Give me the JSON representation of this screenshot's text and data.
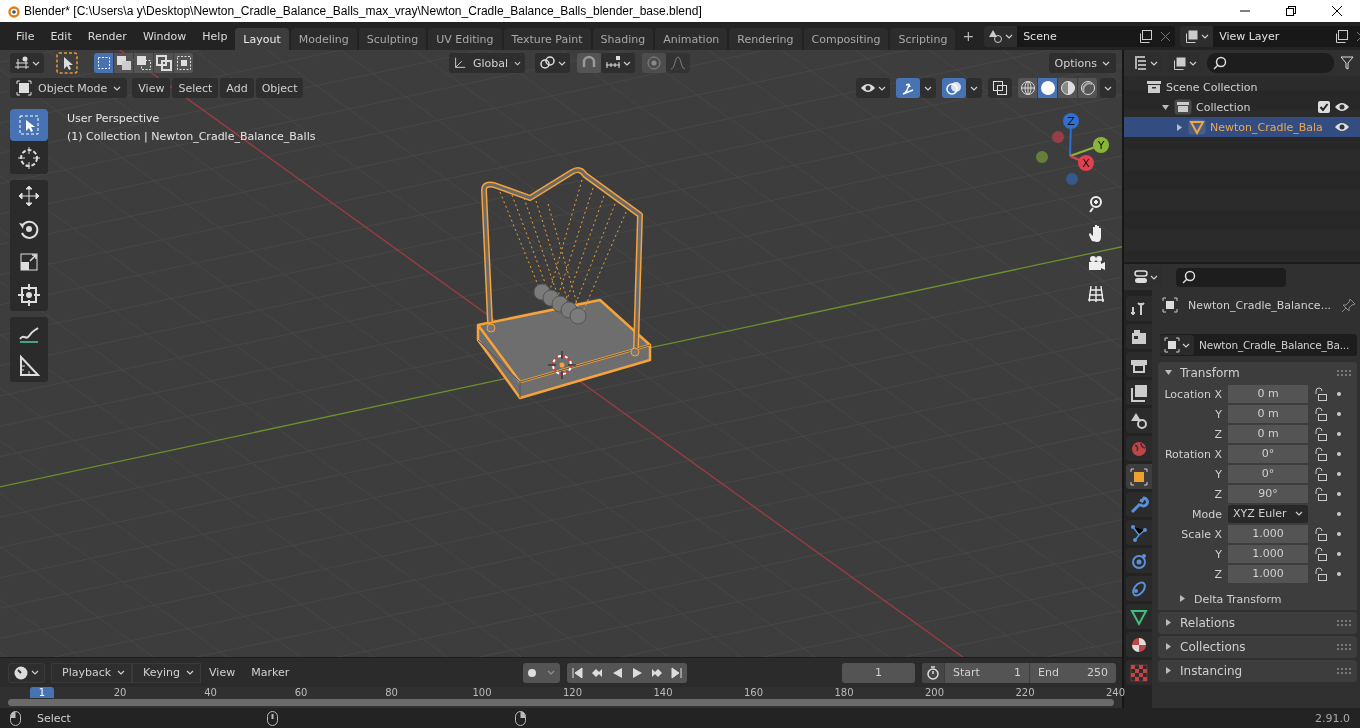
{
  "window": {
    "title": "Blender* [C:\\Users\\a y\\Desktop\\Newton_Cradle_Balance_Balls_max_vray\\Newton_Cradle_Balance_Balls_blender_base.blend]"
  },
  "menu": [
    "File",
    "Edit",
    "Render",
    "Window",
    "Help"
  ],
  "workspaces": [
    {
      "label": "Layout",
      "selected": true
    },
    {
      "label": "Modeling",
      "selected": false
    },
    {
      "label": "Sculpting",
      "selected": false
    },
    {
      "label": "UV Editing",
      "selected": false
    },
    {
      "label": "Texture Paint",
      "selected": false
    },
    {
      "label": "Shading",
      "selected": false
    },
    {
      "label": "Animation",
      "selected": false
    },
    {
      "label": "Rendering",
      "selected": false
    },
    {
      "label": "Compositing",
      "selected": false
    },
    {
      "label": "Scripting",
      "selected": false
    }
  ],
  "add_workspace": "+",
  "scene": {
    "value": "Scene"
  },
  "view_layer": {
    "value": "View Layer"
  },
  "viewport": {
    "select_modes": [
      {
        "selected": true
      },
      {
        "selected": false
      },
      {
        "selected": false
      },
      {
        "selected": false
      },
      {
        "selected": false
      }
    ],
    "orientation": "Global",
    "options": "Options",
    "mode": "Object Mode",
    "menus": [
      "View",
      "Select",
      "Add",
      "Object"
    ],
    "overlay_text": [
      "User Perspective",
      "(1) Collection | Newton_Cradle_Balance_Balls"
    ],
    "toolbar": [
      {
        "tools": [
          {
            "kind": "select",
            "selected": true
          },
          {
            "kind": "cursor",
            "selected": false
          }
        ]
      },
      {
        "tools": [
          {
            "kind": "move",
            "selected": false
          },
          {
            "kind": "rotate",
            "selected": false
          },
          {
            "kind": "scale",
            "selected": false
          },
          {
            "kind": "transform",
            "selected": false
          }
        ]
      },
      {
        "tools": [
          {
            "kind": "annotate",
            "selected": false
          },
          {
            "kind": "measure",
            "selected": false
          }
        ]
      }
    ],
    "shading": [
      {
        "kind": "wireframe",
        "selected": false
      },
      {
        "kind": "solid",
        "selected": true
      },
      {
        "kind": "material",
        "selected": false
      },
      {
        "kind": "rendered",
        "selected": false
      }
    ],
    "gizmo": [
      {
        "label": "Z",
        "color": "#2f6fd0"
      },
      {
        "label": "Y",
        "color": "#8ab536"
      },
      {
        "label": "X",
        "color": "#e0404f"
      }
    ]
  },
  "outliner": {
    "items": [
      {
        "label": "Scene Collection",
        "selected": false,
        "children": [
          {
            "label": "Collection",
            "selected": false,
            "expanded": true,
            "checked": true,
            "children": [
              {
                "label": "Newton_Cradle_Bala",
                "selected": true,
                "expanded": false
              }
            ]
          }
        ]
      }
    ]
  },
  "properties": {
    "tabs": [
      {
        "kind": "tool",
        "selected": false
      },
      {
        "kind": "render",
        "selected": false
      },
      {
        "kind": "output",
        "selected": false
      },
      {
        "kind": "view_layer",
        "selected": false
      },
      {
        "kind": "scene",
        "selected": false
      },
      {
        "kind": "world",
        "selected": false
      },
      {
        "kind": "object",
        "selected": true
      },
      {
        "kind": "modifiers",
        "selected": false
      },
      {
        "kind": "particles",
        "selected": false
      },
      {
        "kind": "physics",
        "selected": false
      },
      {
        "kind": "constraints",
        "selected": false
      },
      {
        "kind": "data",
        "selected": false
      },
      {
        "kind": "material",
        "selected": false
      },
      {
        "kind": "texture",
        "selected": false
      }
    ],
    "object_name": "Newton_Cradle_Balance...",
    "data_name": "Newton_Cradle_Balance_Ba...",
    "transform": {
      "title": "Transform",
      "expanded": true,
      "rows": [
        {
          "label": "Location X",
          "value": "0 m",
          "kind": "number"
        },
        {
          "label": "Y",
          "value": "0 m",
          "kind": "number"
        },
        {
          "label": "Z",
          "value": "0 m",
          "kind": "number"
        },
        {
          "label": "Rotation X",
          "value": "0°",
          "kind": "number"
        },
        {
          "label": "Y",
          "value": "0°",
          "kind": "number"
        },
        {
          "label": "Z",
          "value": "90°",
          "kind": "number"
        },
        {
          "label": "Mode",
          "value": "XYZ Euler",
          "kind": "dropdown"
        },
        {
          "label": "Scale X",
          "value": "1.000",
          "kind": "number"
        },
        {
          "label": "Y",
          "value": "1.000",
          "kind": "number"
        },
        {
          "label": "Z",
          "value": "1.000",
          "kind": "number"
        }
      ],
      "subpanel": {
        "title": "Delta Transform",
        "expanded": false
      }
    },
    "panels": [
      {
        "title": "Relations",
        "expanded": false
      },
      {
        "title": "Collections",
        "expanded": false
      },
      {
        "title": "Instancing",
        "expanded": false
      }
    ]
  },
  "timeline": {
    "menus": [
      "Playback",
      "Keying"
    ],
    "plain_menus": [
      "View",
      "Marker"
    ],
    "current_frame": "1",
    "start_label": "Start",
    "start": "1",
    "end_label": "End",
    "end": "250",
    "frame_marker": "1",
    "ticks": [
      "20",
      "40",
      "60",
      "80",
      "100",
      "120",
      "140",
      "160",
      "180",
      "200",
      "220",
      "240"
    ]
  },
  "status_bar": {
    "action": "Select",
    "version": "2.91.0"
  }
}
